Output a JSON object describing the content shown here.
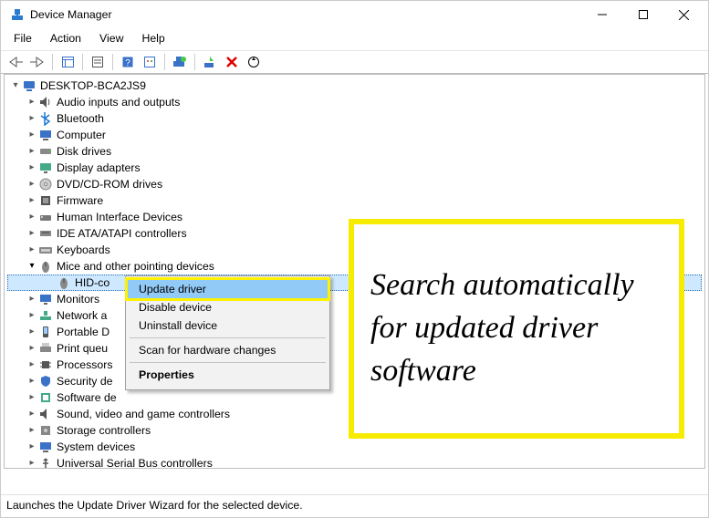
{
  "window": {
    "title": "Device Manager",
    "status": "Launches the Update Driver Wizard for the selected device."
  },
  "menus": {
    "file": "File",
    "action": "Action",
    "view": "View",
    "help": "Help"
  },
  "root": "DESKTOP-BCA2JS9",
  "categories": {
    "audio": "Audio inputs and outputs",
    "bluetooth": "Bluetooth",
    "computer": "Computer",
    "disk": "Disk drives",
    "display": "Display adapters",
    "dvd": "DVD/CD-ROM drives",
    "firmware": "Firmware",
    "hid": "Human Interface Devices",
    "ide": "IDE ATA/ATAPI controllers",
    "keyboards": "Keyboards",
    "mice": "Mice and other pointing devices",
    "monitors": "Monitors",
    "network": "Network a",
    "portable": "Portable D",
    "printq": "Print queu",
    "processors": "Processors",
    "security": "Security de",
    "software": "Software de",
    "sound": "Sound, video and game controllers",
    "storage": "Storage controllers",
    "system": "System devices",
    "usb": "Universal Serial Bus controllers"
  },
  "device": {
    "hid_mouse": "HID-co"
  },
  "context_menu": {
    "update": "Update driver",
    "disable": "Disable device",
    "uninstall": "Uninstall device",
    "scan": "Scan for hardware changes",
    "properties": "Properties"
  },
  "note": "Search automatically for updated driver software"
}
